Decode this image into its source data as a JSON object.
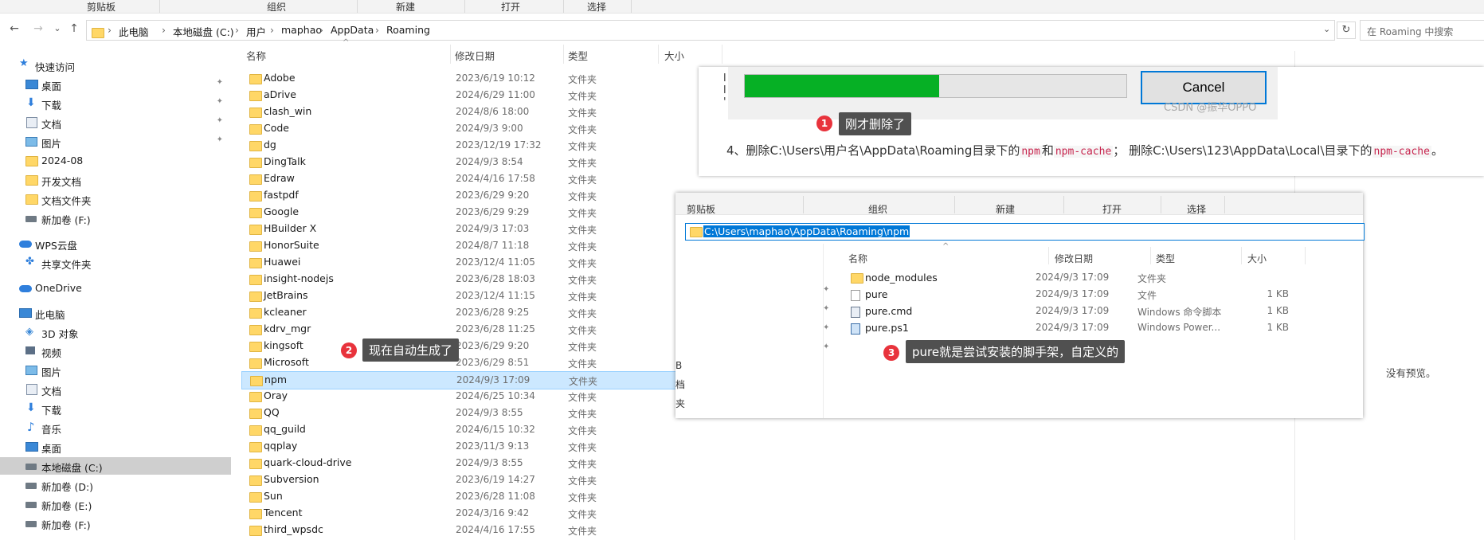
{
  "ribbon": {
    "clipboard": "剪贴板",
    "organize": "组织",
    "new": "新建",
    "open": "打开",
    "select": "选择"
  },
  "nav": {
    "back": "←",
    "forward": "→",
    "recent": "⌄",
    "up": "↑",
    "refresh": "↻",
    "dropdown": "⌄"
  },
  "breadcrumb": [
    "此电脑",
    "本地磁盘 (C:)",
    "用户",
    "maphao",
    "AppData",
    "Roaming"
  ],
  "search": {
    "placeholder": "在 Roaming 中搜索"
  },
  "sidebar": [
    {
      "label": "快速访问",
      "icon": "star-icon"
    },
    {
      "label": "桌面",
      "icon": "desktop-icon",
      "pinned": true
    },
    {
      "label": "下载",
      "icon": "download-icon",
      "pinned": true
    },
    {
      "label": "文档",
      "icon": "documents-icon",
      "pinned": true
    },
    {
      "label": "图片",
      "icon": "pictures-icon",
      "pinned": true
    },
    {
      "label": "2024-08",
      "icon": "folder-icon"
    },
    {
      "label": "开发文档",
      "icon": "folder-icon"
    },
    {
      "label": "文档文件夹",
      "icon": "folder-icon"
    },
    {
      "label": "新加卷 (F:)",
      "icon": "drive-icon"
    },
    {
      "label": "WPS云盘",
      "icon": "cloud-icon"
    },
    {
      "label": "共享文件夹",
      "icon": "shared-icon"
    },
    {
      "label": "OneDrive",
      "icon": "cloud-icon"
    },
    {
      "label": "此电脑",
      "icon": "computer-icon"
    },
    {
      "label": "3D 对象",
      "icon": "3d-objects-icon"
    },
    {
      "label": "视频",
      "icon": "video-icon"
    },
    {
      "label": "图片",
      "icon": "pictures-icon"
    },
    {
      "label": "文档",
      "icon": "documents-icon"
    },
    {
      "label": "下载",
      "icon": "download-icon"
    },
    {
      "label": "音乐",
      "icon": "music-icon"
    },
    {
      "label": "桌面",
      "icon": "desktop-icon"
    },
    {
      "label": "本地磁盘 (C:)",
      "icon": "drive-icon",
      "selected": true
    },
    {
      "label": "新加卷 (D:)",
      "icon": "drive-icon"
    },
    {
      "label": "新加卷 (E:)",
      "icon": "drive-icon"
    },
    {
      "label": "新加卷 (F:)",
      "icon": "drive-icon"
    }
  ],
  "columns": {
    "name": "名称",
    "date": "修改日期",
    "type": "类型",
    "size": "大小"
  },
  "files": [
    {
      "name": "Adobe",
      "date": "2023/6/19 10:12",
      "type": "文件夹"
    },
    {
      "name": "aDrive",
      "date": "2024/6/29 11:00",
      "type": "文件夹"
    },
    {
      "name": "clash_win",
      "date": "2024/8/6 18:00",
      "type": "文件夹"
    },
    {
      "name": "Code",
      "date": "2024/9/3 9:00",
      "type": "文件夹"
    },
    {
      "name": "dg",
      "date": "2023/12/19 17:32",
      "type": "文件夹"
    },
    {
      "name": "DingTalk",
      "date": "2024/9/3 8:54",
      "type": "文件夹"
    },
    {
      "name": "Edraw",
      "date": "2024/4/16 17:58",
      "type": "文件夹"
    },
    {
      "name": "fastpdf",
      "date": "2023/6/29 9:20",
      "type": "文件夹"
    },
    {
      "name": "Google",
      "date": "2023/6/29 9:29",
      "type": "文件夹"
    },
    {
      "name": "HBuilder X",
      "date": "2024/9/3 17:03",
      "type": "文件夹"
    },
    {
      "name": "HonorSuite",
      "date": "2024/8/7 11:18",
      "type": "文件夹"
    },
    {
      "name": "Huawei",
      "date": "2023/12/4 11:05",
      "type": "文件夹"
    },
    {
      "name": "insight-nodejs",
      "date": "2023/6/28 18:03",
      "type": "文件夹"
    },
    {
      "name": "JetBrains",
      "date": "2023/12/4 11:15",
      "type": "文件夹"
    },
    {
      "name": "kcleaner",
      "date": "2023/6/28 9:25",
      "type": "文件夹"
    },
    {
      "name": "kdrv_mgr",
      "date": "2023/6/28 11:25",
      "type": "文件夹"
    },
    {
      "name": "kingsoft",
      "date": "2023/6/29 9:20",
      "type": "文件夹"
    },
    {
      "name": "Microsoft",
      "date": "2023/6/29 8:51",
      "type": "文件夹"
    },
    {
      "name": "npm",
      "date": "2024/9/3 17:09",
      "type": "文件夹",
      "selected": true
    },
    {
      "name": "Oray",
      "date": "2024/6/25 10:34",
      "type": "文件夹"
    },
    {
      "name": "QQ",
      "date": "2024/9/3 8:55",
      "type": "文件夹"
    },
    {
      "name": "qq_guild",
      "date": "2024/6/15 10:32",
      "type": "文件夹"
    },
    {
      "name": "qqplay",
      "date": "2023/11/3 9:13",
      "type": "文件夹"
    },
    {
      "name": "quark-cloud-drive",
      "date": "2024/9/3 8:55",
      "type": "文件夹"
    },
    {
      "name": "Subversion",
      "date": "2023/6/19 14:27",
      "type": "文件夹"
    },
    {
      "name": "Sun",
      "date": "2023/6/28 11:08",
      "type": "文件夹"
    },
    {
      "name": "Tencent",
      "date": "2024/3/16 9:42",
      "type": "文件夹"
    },
    {
      "name": "third_wpsdc",
      "date": "2024/4/16 17:55",
      "type": "文件夹"
    }
  ],
  "preview": {
    "text": "没有预览。"
  },
  "overlay1": {
    "cancel_label": "Cancel",
    "progress": 0.51,
    "watermark": "CSDN @振华OPPO",
    "callout_number": "1",
    "callout": "刚才删除了",
    "step_prefix": "4、删除C:\\Users\\用户名\\AppData\\Roaming目录下的",
    "code1": "npm",
    "and": "和",
    "code2": "npm-cache",
    "mid": "； 删除C:\\Users\\123\\AppData\\Local\\目录下的",
    "code3": "npm-cache",
    "end": "。"
  },
  "callout2": {
    "number": "2",
    "text": "现在自动生成了"
  },
  "overlay2": {
    "ribbon": {
      "clipboard": "剪贴板",
      "organize": "组织",
      "new": "新建",
      "open": "打开",
      "select": "选择"
    },
    "address": "C:\\Users\\maphao\\AppData\\Roaming\\npm",
    "columns": {
      "name": "名称",
      "date": "修改日期",
      "type": "类型",
      "size": "大小"
    },
    "files": [
      {
        "name": "node_modules",
        "date": "2024/9/3 17:09",
        "type": "文件夹",
        "size": "",
        "icon": "folder-icon"
      },
      {
        "name": "pure",
        "date": "2024/9/3 17:09",
        "type": "文件",
        "size": "1 KB",
        "icon": "file-icon"
      },
      {
        "name": "pure.cmd",
        "date": "2024/9/3 17:09",
        "type": "Windows 命令脚本",
        "size": "1 KB",
        "icon": "cmd-file-icon"
      },
      {
        "name": "pure.ps1",
        "date": "2024/9/3 17:09",
        "type": "Windows Power...",
        "size": "1 KB",
        "icon": "powershell-file-icon"
      }
    ],
    "side_fragments": [
      "B",
      "档",
      "夹"
    ],
    "callout_number": "3",
    "callout": "pure就是尝试安装的脚手架，自定义的"
  }
}
